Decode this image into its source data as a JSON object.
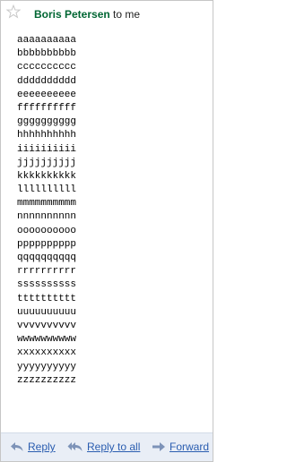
{
  "header": {
    "sender": "Boris Petersen",
    "recipient_text": " to me"
  },
  "message": {
    "lines": [
      "aaaaaaaaaa",
      "bbbbbbbbbb",
      "cccccccccc",
      "dddddddddd",
      "eeeeeeeeee",
      "ffffffffff",
      "gggggggggg",
      "hhhhhhhhhh",
      "iiiiiiiiii",
      "jjjjjjjjjj",
      "kkkkkkkkkk",
      "llllllllll",
      "mmmmmmmmmm",
      "nnnnnnnnnn",
      "oooooooooo",
      "pppppppppp",
      "qqqqqqqqqq",
      "rrrrrrrrrr",
      "ssssssssss",
      "tttttttttt",
      "uuuuuuuuuu",
      "vvvvvvvvvv",
      "wwwwwwwwww",
      "xxxxxxxxxx",
      "yyyyyyyyyy",
      "zzzzzzzzzz"
    ]
  },
  "actions": {
    "reply": "Reply",
    "reply_all": "Reply to all",
    "forward": "Forward"
  },
  "icons": {
    "star": "star-icon",
    "reply": "reply-arrow-icon",
    "reply_all": "reply-all-arrow-icon",
    "forward": "forward-arrow-icon"
  },
  "colors": {
    "sender": "#006633",
    "link": "#2a5db0",
    "footer_bg": "#e9eef6"
  }
}
